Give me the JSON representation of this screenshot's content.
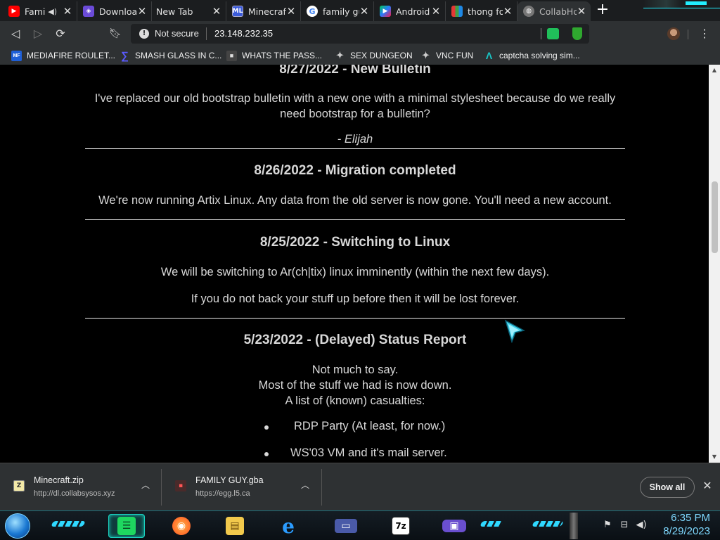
{
  "browser": {
    "tabs": [
      {
        "title": "Fami",
        "icon": "youtube-icon",
        "color": "#ff0000",
        "glyph": "▶",
        "muted_audio": true
      },
      {
        "title": "Downloa",
        "icon": "download-site-icon",
        "color": "#6b4bd8",
        "glyph": "◈"
      },
      {
        "title": "New Tab",
        "icon": "new-tab-icon",
        "color": "",
        "glyph": ""
      },
      {
        "title": "Minecraf",
        "icon": "ml-icon",
        "color": "#3b5bdb",
        "glyph": "ML"
      },
      {
        "title": "family gu",
        "icon": "google-icon",
        "color": "#ffffff",
        "glyph": "G"
      },
      {
        "title": "Android",
        "icon": "google-play-icon",
        "color": "#1e88e5",
        "glyph": "▶"
      },
      {
        "title": "thong fo",
        "icon": "bars-icon",
        "color": "#e53935",
        "glyph": "▮"
      },
      {
        "title": "CollabHo",
        "icon": "globe-icon",
        "color": "#777777",
        "glyph": "◍",
        "active": true
      }
    ],
    "new_tab_label": "+",
    "address": {
      "security_label": "Not secure",
      "url": "23.148.232.35"
    },
    "bookmarks": [
      {
        "label": "MEDIAFIRE ROULET...",
        "icon": "mediafire-icon",
        "glyph": "MF",
        "color": "#1f5fd6"
      },
      {
        "label": "SMASH GLASS IN C...",
        "icon": "smash-icon",
        "glyph": "∑",
        "color": "#3b3bd6"
      },
      {
        "label": "WHATS THE PASS...",
        "icon": "lock-page-icon",
        "glyph": "■",
        "color": "#444444"
      },
      {
        "label": "SEX DUNGEON",
        "icon": "vnc-icon",
        "glyph": "✦",
        "color": "#bbbbbb"
      },
      {
        "label": "VNC FUN",
        "icon": "vnc-icon",
        "glyph": "✦",
        "color": "#bbbbbb"
      },
      {
        "label": "captcha solving sim...",
        "icon": "captcha-icon",
        "glyph": "Λ",
        "color": "#19c4c4"
      }
    ]
  },
  "page": {
    "posts": [
      {
        "heading": "8/27/2022 - New Bulletin",
        "body_line1": "I've replaced our old bootstrap bulletin with a new one with a minimal stylesheet because do we really",
        "body_line2": "need bootstrap for a bulletin?",
        "signature": "- Elijah"
      },
      {
        "heading": "8/26/2022 - Migration completed",
        "body": "We're now running Artix Linux. Any data from the old server is now gone. You'll need a new account."
      },
      {
        "heading": "8/25/2022 - Switching to Linux",
        "body_p1": "We will be switching to Ar(ch|tix) linux imminently (within the next few days).",
        "body_p2": "If you do not back your stuff up before then it will be lost forever."
      },
      {
        "heading": "5/23/2022 - (Delayed) Status Report",
        "lines": [
          "Not much to say.",
          "Most of the stuff we had is now down.",
          "A list of (known) casualties:"
        ],
        "list": [
          "RDP Party (At least, for now.)",
          "WS'03 VM and it's mail server."
        ]
      }
    ]
  },
  "downloads": {
    "items": [
      {
        "name": "Minecraft.zip",
        "source": "http://dl.collabsysos.xyz",
        "icon": "zip-file-icon"
      },
      {
        "name": "FAMILY GUY.gba",
        "source": "https://egg.l5.ca",
        "icon": "gba-file-icon"
      }
    ],
    "show_all_label": "Show all"
  },
  "taskbar": {
    "apps": [
      {
        "name": "spotify-like-app",
        "icon": "document-app-icon",
        "glyph": "☰",
        "color": "#1ed760"
      },
      {
        "name": "firefox",
        "icon": "firefox-icon",
        "glyph": "◉",
        "color": "#ff7a18"
      },
      {
        "name": "file-explorer",
        "icon": "folder-icon",
        "glyph": "▤",
        "color": "#f2c94c"
      },
      {
        "name": "internet-explorer",
        "icon": "ie-icon",
        "glyph": "e",
        "color": "#1e90ff"
      },
      {
        "name": "card-app",
        "icon": "card-icon",
        "glyph": "▭",
        "color": "#4a5aa8"
      },
      {
        "name": "7zip",
        "icon": "7zip-icon",
        "glyph": "7z",
        "color": "#ffffff"
      },
      {
        "name": "gameboy-emulator",
        "icon": "gameboy-icon",
        "glyph": "▣",
        "color": "#6a4fcf"
      }
    ],
    "clock": {
      "time": "6:35 PM",
      "date": "8/29/2023"
    }
  }
}
